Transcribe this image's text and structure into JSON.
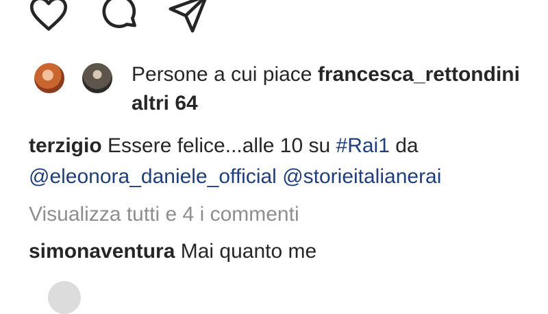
{
  "post": {
    "actions": {
      "like_icon": "heart-icon",
      "comment_icon": "comment-icon",
      "share_icon": "send-icon"
    },
    "likes": {
      "prefix": "Persone a cui piace ",
      "first_user": "francesca_rettondini",
      "others": "altri 64"
    },
    "caption": {
      "username": "terzigio",
      "text_before_tag": " Essere felice...alle 10 su ",
      "hashtag": "#Rai1",
      "text_after_tag": " da",
      "mention1": "@eleonora_daniele_official",
      "mention2": "@storieitalianerai"
    },
    "view_all_comments": "Visualizza tutti e 4 i commenti",
    "comment": {
      "username": "simonaventura",
      "text": " Mai quanto me"
    }
  },
  "colors": {
    "text": "#262626",
    "link": "#1e3f7a",
    "muted": "#8e8e8e"
  }
}
